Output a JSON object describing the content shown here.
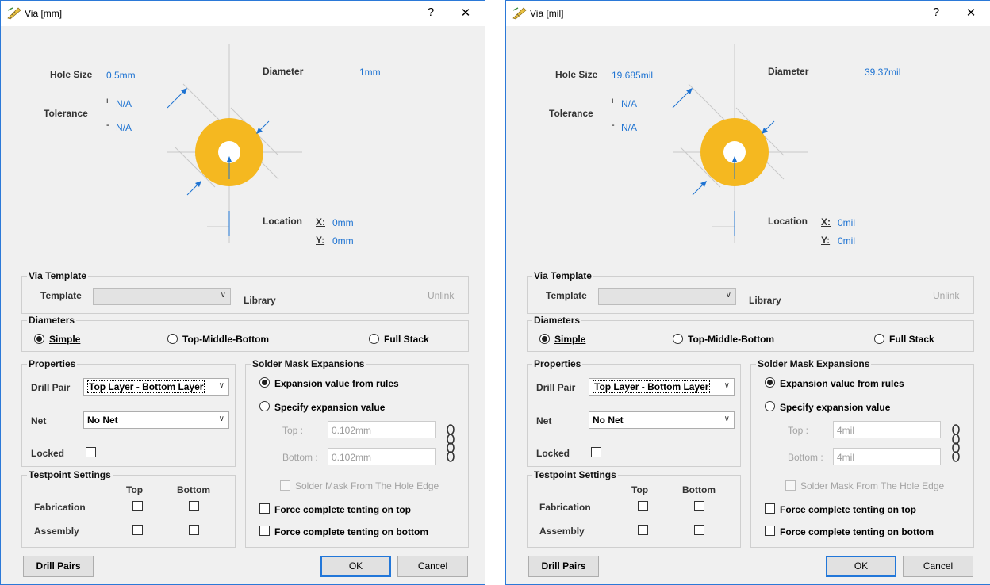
{
  "accent_color": "#1e73d2",
  "pad_color": "#f5b820",
  "dialogs": [
    {
      "title": "Via [mm]",
      "help": "?",
      "close": "✕",
      "diagram": {
        "hole_size_label": "Hole Size",
        "hole_size_value": "0.5mm",
        "diameter_label": "Diameter",
        "diameter_value": "1mm",
        "tolerance_label": "Tolerance",
        "tol_plus_sign": "+",
        "tol_plus_value": "N/A",
        "tol_minus_sign": "-",
        "tol_minus_value": "N/A",
        "location_label": "Location",
        "x_label": "X:",
        "x_value": "0mm",
        "y_label": "Y:",
        "y_value": "0mm"
      },
      "via_template": {
        "title": "Via Template",
        "template_label": "Template",
        "template_value": "",
        "library_label": "Library",
        "unlink_label": "Unlink"
      },
      "diameters": {
        "title": "Diameters",
        "simple": "Simple",
        "top_middle_bottom": "Top-Middle-Bottom",
        "full_stack": "Full Stack",
        "selected": "Simple"
      },
      "properties": {
        "title": "Properties",
        "drill_pair_label": "Drill Pair",
        "drill_pair_value": "Top Layer - Bottom Layer",
        "net_label": "Net",
        "net_value": "No Net",
        "locked_label": "Locked"
      },
      "testpoint": {
        "title": "Testpoint Settings",
        "col_top": "Top",
        "col_bottom": "Bottom",
        "row_fabrication": "Fabrication",
        "row_assembly": "Assembly"
      },
      "solder_mask": {
        "title": "Solder Mask Expansions",
        "from_rules": "Expansion value from rules",
        "specify": "Specify expansion value",
        "top_label": "Top :",
        "top_value": "0.102mm",
        "bottom_label": "Bottom :",
        "bottom_value": "0.102mm",
        "from_hole_edge": "Solder Mask From The Hole Edge",
        "tent_top": "Force complete tenting on top",
        "tent_bottom": "Force complete tenting on bottom"
      },
      "buttons": {
        "drill_pairs": "Drill Pairs",
        "ok": "OK",
        "cancel": "Cancel"
      }
    },
    {
      "title": "Via [mil]",
      "help": "?",
      "close": "✕",
      "diagram": {
        "hole_size_label": "Hole Size",
        "hole_size_value": "19.685mil",
        "diameter_label": "Diameter",
        "diameter_value": "39.37mil",
        "tolerance_label": "Tolerance",
        "tol_plus_sign": "+",
        "tol_plus_value": "N/A",
        "tol_minus_sign": "-",
        "tol_minus_value": "N/A",
        "location_label": "Location",
        "x_label": "X:",
        "x_value": "0mil",
        "y_label": "Y:",
        "y_value": "0mil"
      },
      "via_template": {
        "title": "Via Template",
        "template_label": "Template",
        "template_value": "",
        "library_label": "Library",
        "unlink_label": "Unlink"
      },
      "diameters": {
        "title": "Diameters",
        "simple": "Simple",
        "top_middle_bottom": "Top-Middle-Bottom",
        "full_stack": "Full Stack",
        "selected": "Simple"
      },
      "properties": {
        "title": "Properties",
        "drill_pair_label": "Drill Pair",
        "drill_pair_value": "Top Layer - Bottom Layer",
        "net_label": "Net",
        "net_value": "No Net",
        "locked_label": "Locked"
      },
      "testpoint": {
        "title": "Testpoint Settings",
        "col_top": "Top",
        "col_bottom": "Bottom",
        "row_fabrication": "Fabrication",
        "row_assembly": "Assembly"
      },
      "solder_mask": {
        "title": "Solder Mask Expansions",
        "from_rules": "Expansion value from rules",
        "specify": "Specify expansion value",
        "top_label": "Top :",
        "top_value": "4mil",
        "bottom_label": "Bottom :",
        "bottom_value": "4mil",
        "from_hole_edge": "Solder Mask From The Hole Edge",
        "tent_top": "Force complete tenting on top",
        "tent_bottom": "Force complete tenting on bottom"
      },
      "buttons": {
        "drill_pairs": "Drill Pairs",
        "ok": "OK",
        "cancel": "Cancel"
      }
    }
  ]
}
